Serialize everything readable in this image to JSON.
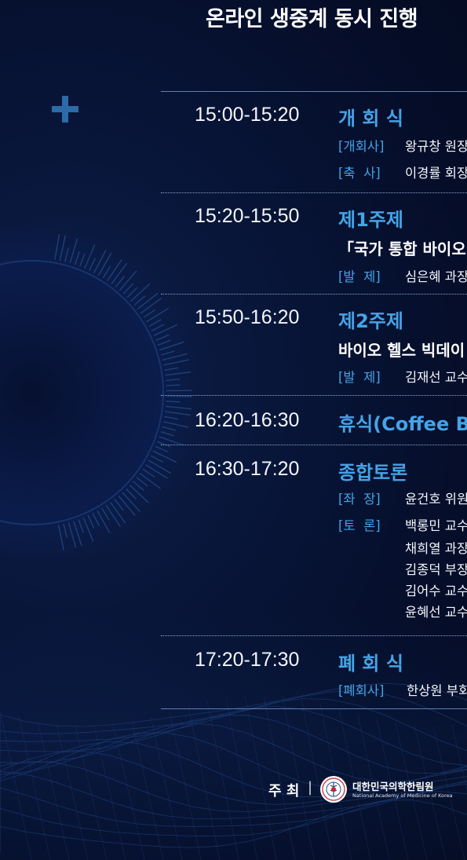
{
  "header": {
    "title": "온라인 생중계 동시 진행"
  },
  "program": [
    {
      "time": "15:00-15:20",
      "title": "개 회 식",
      "lines": [
        {
          "role": "[개회사]",
          "person": "왕규창 원장"
        },
        {
          "role": "[축  사]",
          "person": "이경률 회장"
        }
      ]
    },
    {
      "time": "15:20-15:50",
      "title": "제1주제",
      "topic": "「국가 통합 바이오",
      "lines": [
        {
          "role": "[발  제]",
          "person": "심은혜 과장"
        }
      ]
    },
    {
      "time": "15:50-16:20",
      "title": "제2주제",
      "topic": "바이오 헬스 빅데이",
      "lines": [
        {
          "role": "[발  제]",
          "person": "김재선 교수"
        }
      ]
    },
    {
      "time": "16:20-16:30",
      "title": "휴식(Coffee Br"
    },
    {
      "time": "16:30-17:20",
      "title": "종합토론",
      "lines": [
        {
          "role": "[좌  장]",
          "person": "윤건호 위원"
        },
        {
          "role": "[토  론]",
          "person": "백롱민 교수"
        },
        {
          "role": "",
          "person": "채희열 과장"
        },
        {
          "role": "",
          "person": "김종덕 부장"
        },
        {
          "role": "",
          "person": "김어수 교수"
        },
        {
          "role": "",
          "person": "윤혜선 교수"
        }
      ]
    },
    {
      "time": "17:20-17:30",
      "title": "폐 회 식",
      "lines": [
        {
          "role": "[폐회사]",
          "person": "한상원 부회"
        }
      ]
    }
  ],
  "footer": {
    "host_label": "주 최",
    "separator": "|",
    "org_name_ko": "대한민국의학한림원",
    "org_name_en": "National Academy of Medicine of Korea"
  },
  "colors": {
    "background": "#061233",
    "accent": "#45a3e6",
    "text": "#ffffff",
    "emblem_red": "#c0272d"
  },
  "icons": [
    "plus-icon",
    "academy-emblem-icon"
  ]
}
